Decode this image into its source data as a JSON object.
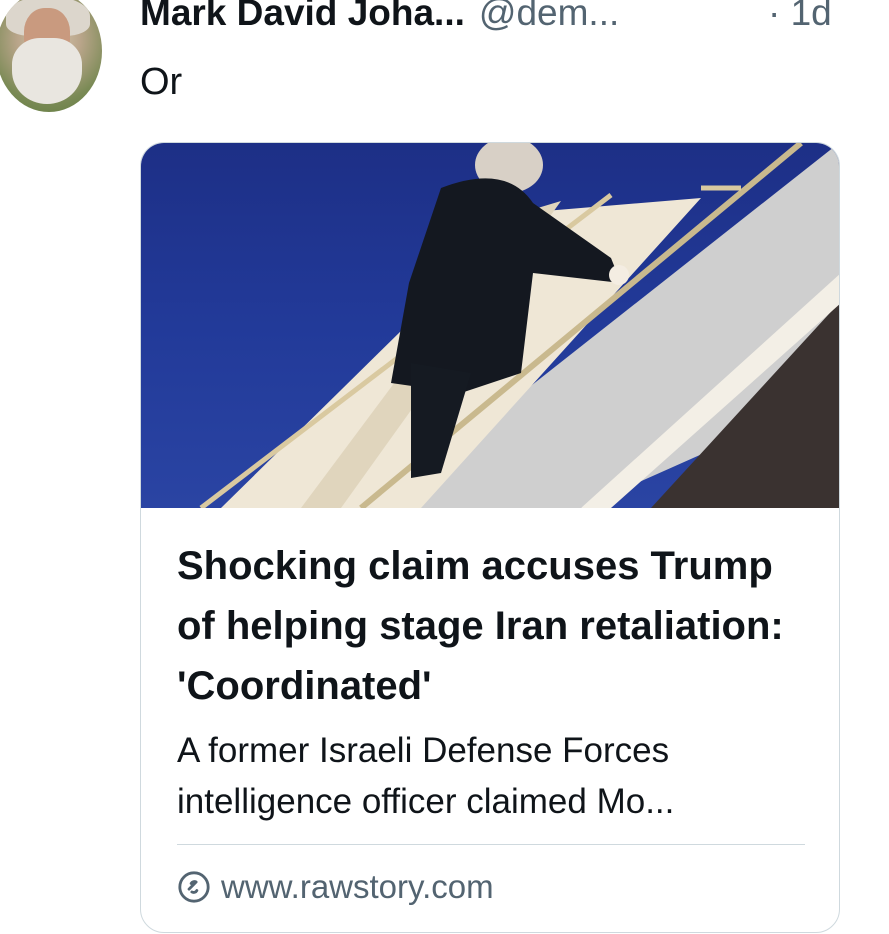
{
  "tweet": {
    "author": {
      "display_name": "Mark David Joha...",
      "handle": "@dem...",
      "time": "· 1d"
    },
    "text": "Or"
  },
  "card": {
    "title": "Shocking claim accuses Trump of helping stage Iran retaliation: 'Coordinated'",
    "description": "A former Israeli Defense Forces intelligence officer claimed Mo...",
    "domain": "www.rawstory.com",
    "domain_icon": "link-icon"
  },
  "colors": {
    "text_primary": "#0f1419",
    "text_secondary": "#536471",
    "border": "#cfd9de",
    "sky": "#223a99"
  }
}
